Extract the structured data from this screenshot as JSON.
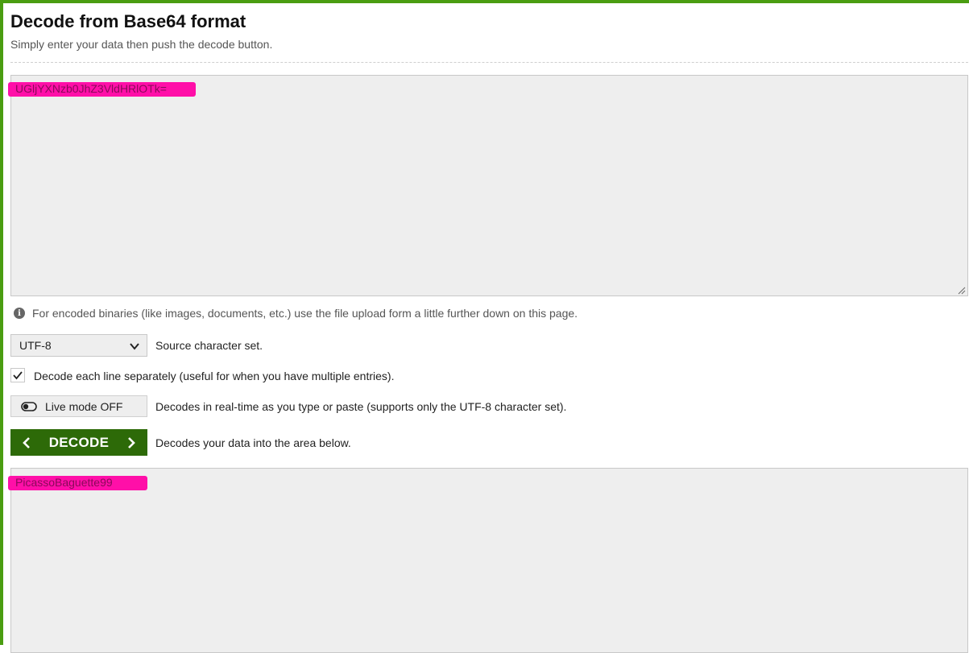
{
  "header": {
    "title": "Decode from Base64 format",
    "subtitle": "Simply enter your data then push the decode button."
  },
  "input": {
    "value": "UGljYXNzb0JhZ3VldHRlOTk="
  },
  "info": {
    "icon": "info-icon",
    "text": "For encoded binaries (like images, documents, etc.) use the file upload form a little further down on this page."
  },
  "charset": {
    "selected": "UTF-8",
    "label": "Source character set."
  },
  "options": {
    "each_line_checked": true,
    "each_line_label": "Decode each line separately (useful for when you have multiple entries)."
  },
  "live_mode": {
    "button_label": "Live mode OFF",
    "description": "Decodes in real-time as you type or paste (supports only the UTF-8 character set)."
  },
  "decode": {
    "button_label": "DECODE",
    "description": "Decodes your data into the area below."
  },
  "output": {
    "value": "PicassoBaguette99"
  },
  "colors": {
    "accent_green": "#4a9d11",
    "button_green": "#2d6a08",
    "highlight_pink": "#ff0fa8"
  }
}
